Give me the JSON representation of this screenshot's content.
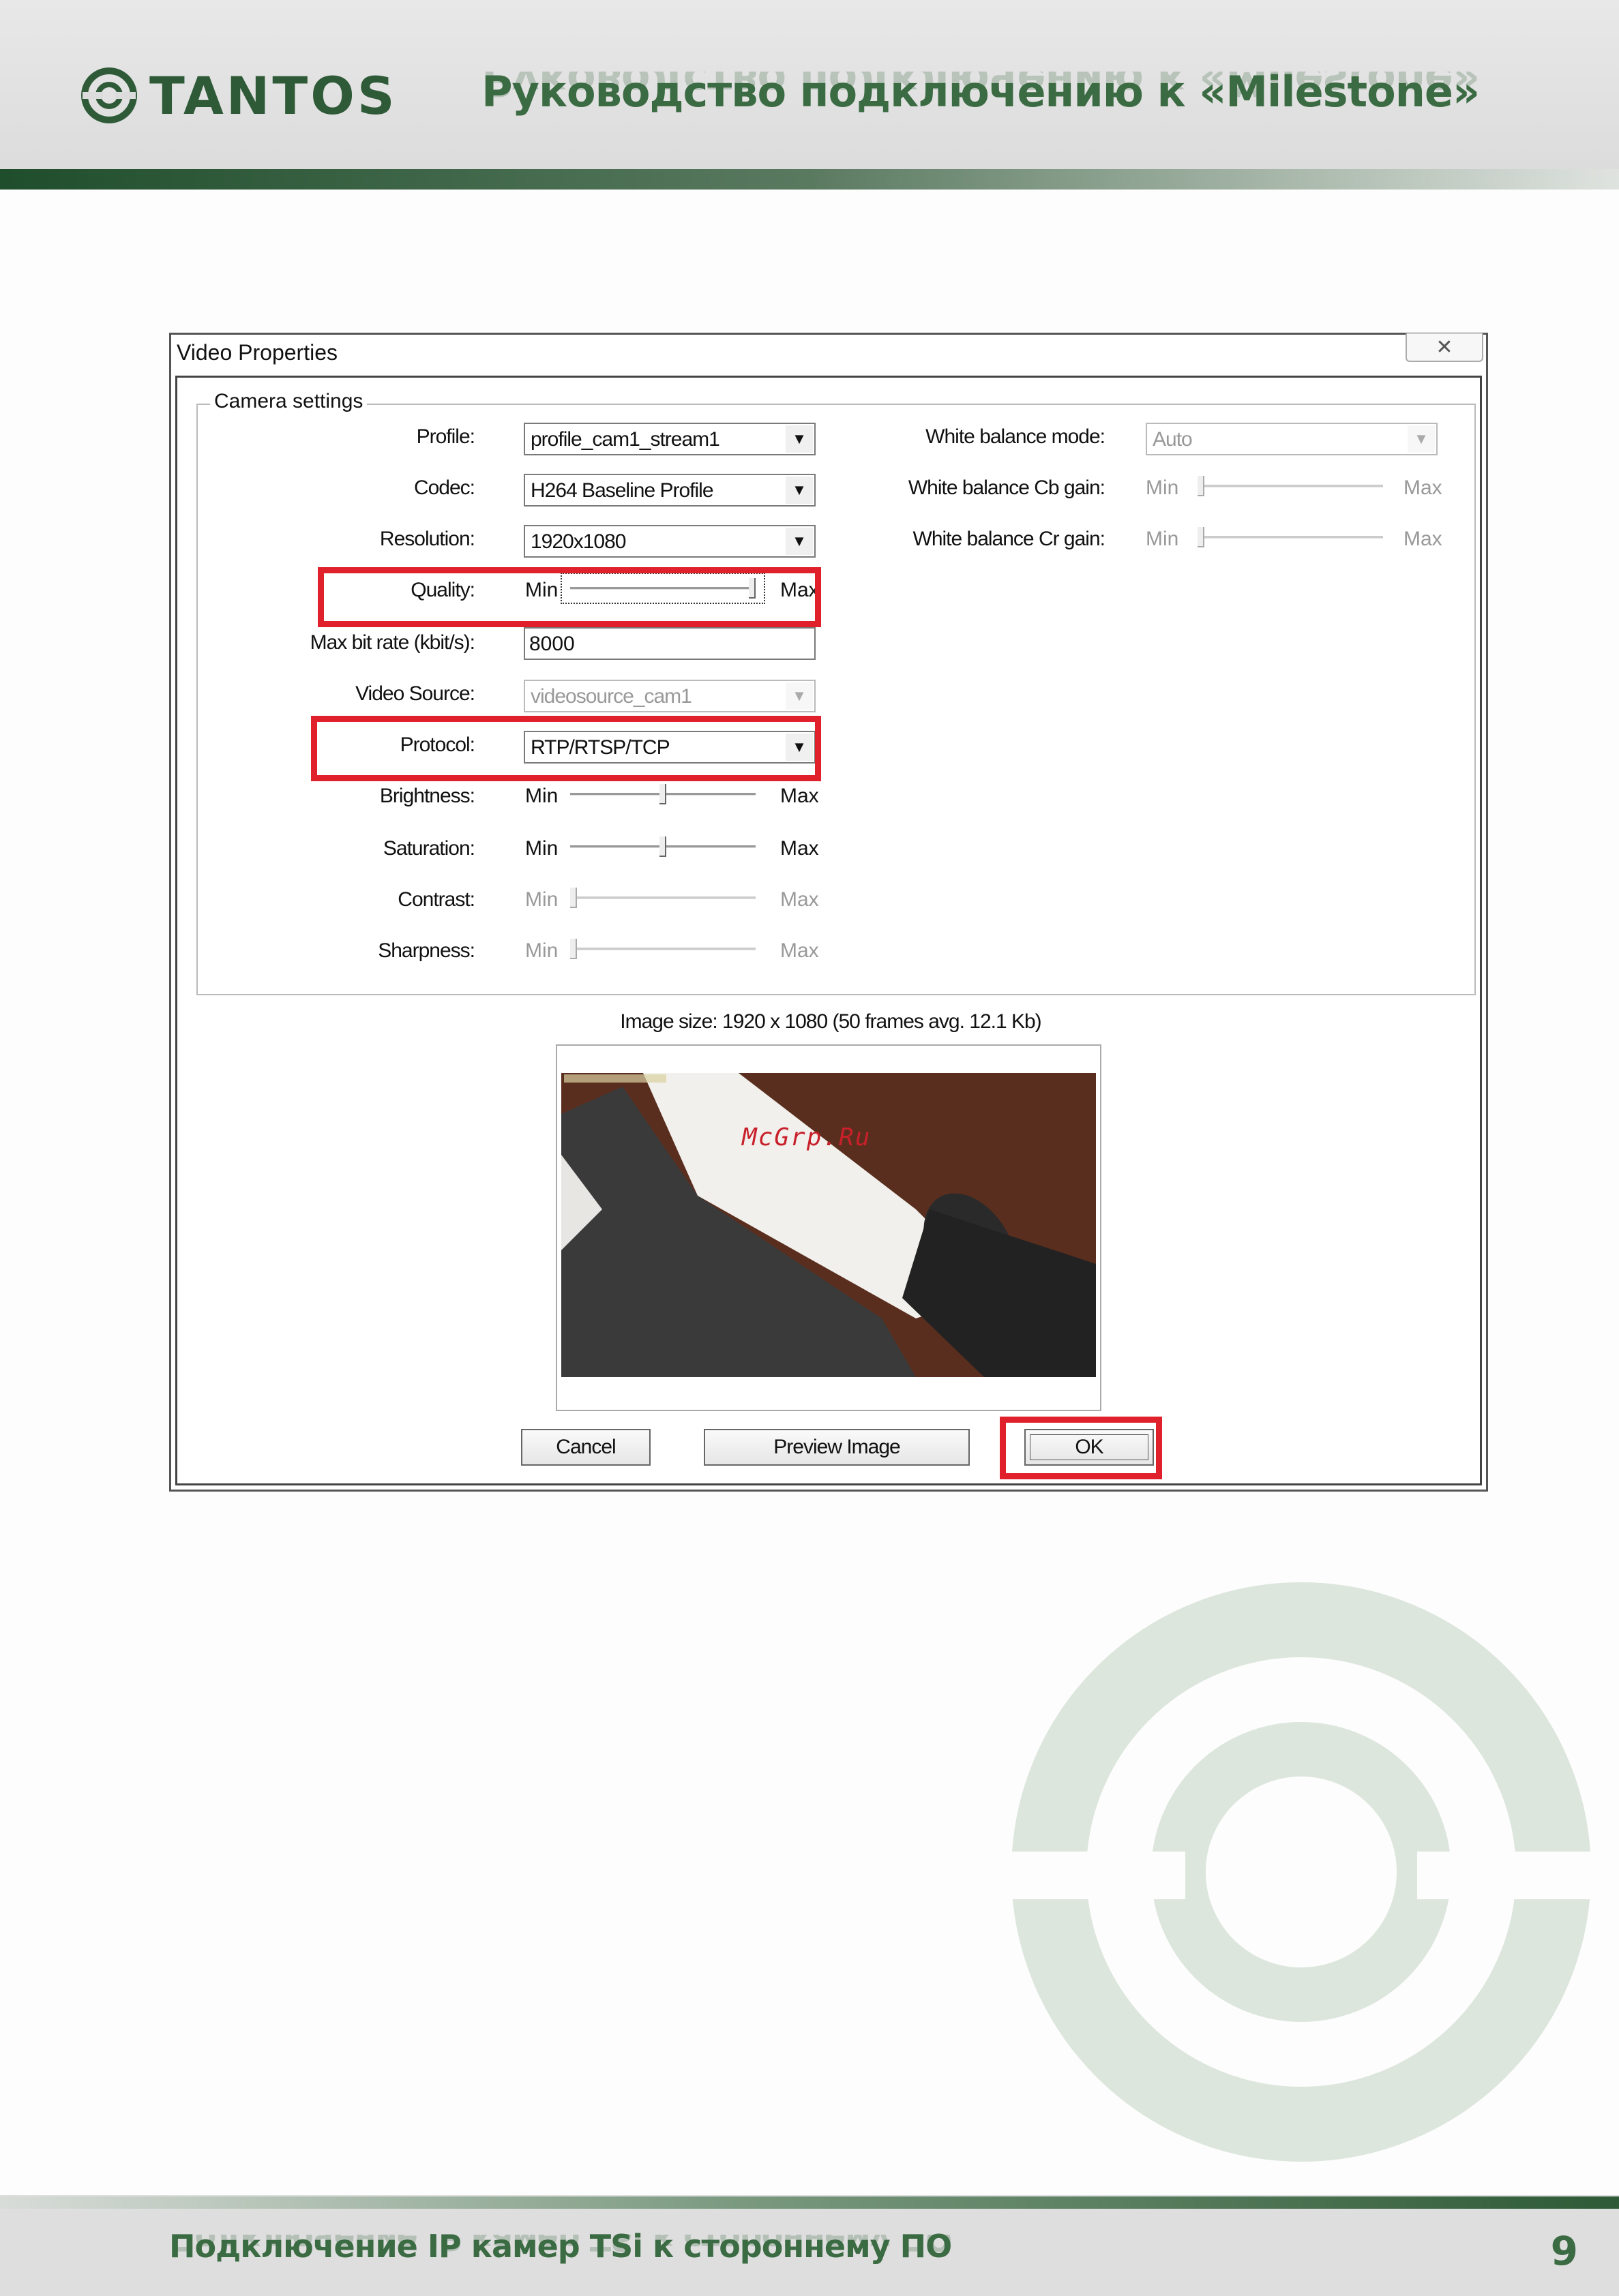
{
  "header": {
    "brand": "TANTOS",
    "title": "Руководство подключению к «Milestone»"
  },
  "dialog": {
    "title": "Video Properties",
    "close_label": "✕",
    "group_label": "Camera settings",
    "profile": {
      "label": "Profile:",
      "value": "profile_cam1_stream1"
    },
    "codec": {
      "label": "Codec:",
      "value": "H264 Baseline Profile"
    },
    "resolution": {
      "label": "Resolution:",
      "value": "1920x1080"
    },
    "quality": {
      "label": "Quality:",
      "min": "Min",
      "max": "Max",
      "level": 1.0
    },
    "max_bitrate": {
      "label": "Max bit rate (kbit/s):",
      "value": "8000"
    },
    "video_source": {
      "label": "Video Source:",
      "value": "videosource_cam1"
    },
    "protocol": {
      "label": "Protocol:",
      "value": "RTP/RTSP/TCP"
    },
    "brightness": {
      "label": "Brightness:",
      "min": "Min",
      "max": "Max",
      "level": 0.5
    },
    "saturation": {
      "label": "Saturation:",
      "min": "Min",
      "max": "Max",
      "level": 0.5
    },
    "contrast": {
      "label": "Contrast:",
      "min": "Min",
      "max": "Max",
      "level": 0.0
    },
    "sharpness": {
      "label": "Sharpness:",
      "min": "Min",
      "max": "Max",
      "level": 0.0
    },
    "wb_mode": {
      "label": "White balance mode:",
      "value": "Auto"
    },
    "wb_cb": {
      "label": "White balance Cb gain:",
      "min": "Min",
      "max": "Max",
      "level": 0.0
    },
    "wb_cr": {
      "label": "White balance Cr gain:",
      "min": "Min",
      "max": "Max",
      "level": 0.0
    },
    "image_size": "Image size: 1920 x 1080 (50 frames avg. 12.1 Kb)",
    "watermark": "McGrp.Ru",
    "buttons": {
      "cancel": "Cancel",
      "preview": "Preview Image",
      "ok": "OK"
    }
  },
  "footer": {
    "title": "Подключение IP камер TSi к стороннему ПО",
    "page": "9"
  },
  "colors": {
    "brand_green": "#3b6b42",
    "highlight_red": "#e0202a"
  },
  "icons": [
    "tantos-logo-icon",
    "close-icon",
    "dropdown-arrow-icon"
  ]
}
